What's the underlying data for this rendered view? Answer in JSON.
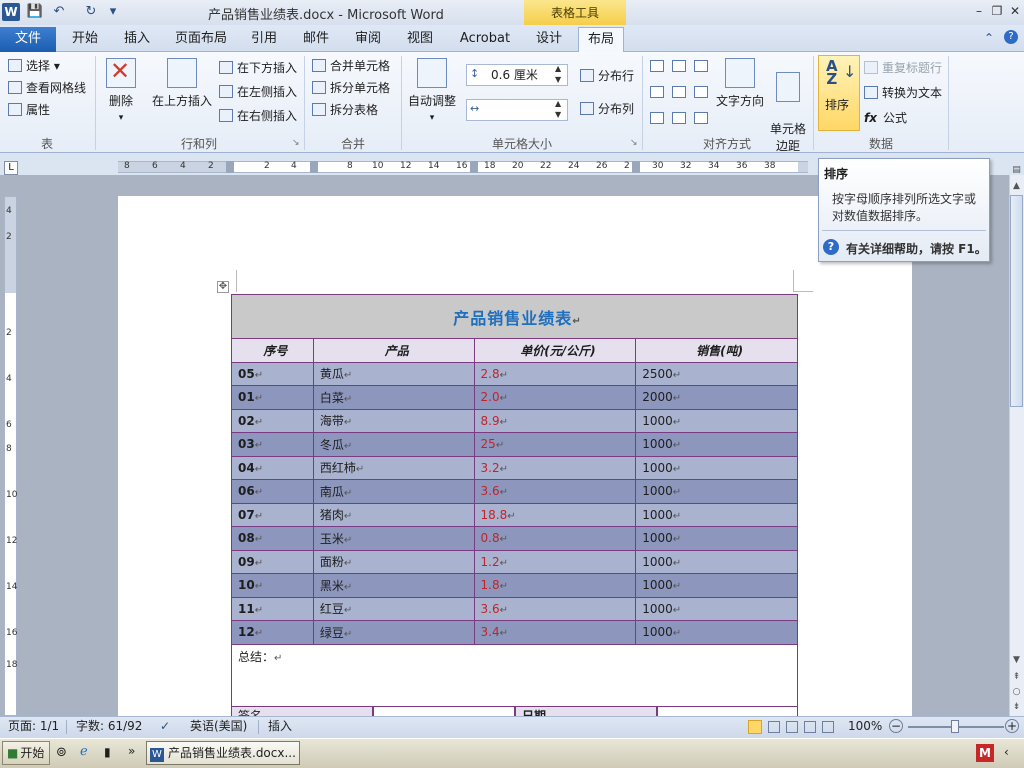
{
  "app": {
    "title": "产品销售业绩表.docx - Microsoft Word",
    "context_tab": "表格工具"
  },
  "tabs": [
    "文件",
    "开始",
    "插入",
    "页面布局",
    "引用",
    "邮件",
    "审阅",
    "视图",
    "Acrobat",
    "设计",
    "布局"
  ],
  "ribbon": {
    "table_group": {
      "label": "表",
      "select": "选择 ▾",
      "view_gridlines": "查看网格线",
      "properties": "属性"
    },
    "rows_cols_group": {
      "label": "行和列",
      "delete": "删除",
      "insert_above": "在上方插入",
      "insert_below": "在下方插入",
      "insert_left": "在左侧插入",
      "insert_right": "在右侧插入"
    },
    "merge_group": {
      "label": "合并",
      "merge_cells": "合并单元格",
      "split_cells": "拆分单元格",
      "split_table": "拆分表格"
    },
    "cell_size_group": {
      "label": "单元格大小",
      "autofit": "自动调整",
      "height_value": "0.6 厘米",
      "width_value": "",
      "distribute_rows": "分布行",
      "distribute_cols": "分布列"
    },
    "align_group": {
      "label": "对齐方式",
      "text_direction": "文字方向",
      "cell_margins": "单元格\n边距"
    },
    "data_group": {
      "label": "数据",
      "sort": "排序",
      "repeat_header": "重复标题行",
      "convert_to_text": "转换为文本",
      "formula": "公式"
    }
  },
  "ruler": {
    "h_ticks": [
      "8",
      "6",
      "4",
      "2",
      "2",
      "4",
      "8",
      "10",
      "12",
      "14",
      "16",
      "18",
      "20",
      "22",
      "24",
      "26",
      "2",
      "30",
      "32",
      "34",
      "36",
      "38"
    ],
    "v_ticks": [
      "4",
      "2",
      "2",
      "4",
      "6",
      "8",
      "10",
      "12",
      "14",
      "16",
      "18"
    ]
  },
  "tooltip": {
    "title": "排序",
    "body": "按字母顺序排列所选文字或对数值数据排序。",
    "help": "有关详细帮助，请按 F1。"
  },
  "document": {
    "table_title": "产品销售业绩表",
    "headers": [
      "序号",
      "产品",
      "单价(元/公斤)",
      "销售(吨)"
    ],
    "rows": [
      {
        "id": "05",
        "product": "黄瓜",
        "price": "2.8",
        "sales": "2500"
      },
      {
        "id": "01",
        "product": "白菜",
        "price": "2.0",
        "sales": "2000"
      },
      {
        "id": "02",
        "product": "海带",
        "price": "8.9",
        "sales": "1000"
      },
      {
        "id": "03",
        "product": "冬瓜",
        "price": "25",
        "sales": "1000"
      },
      {
        "id": "04",
        "product": "西红柿",
        "price": "3.2",
        "sales": "1000"
      },
      {
        "id": "06",
        "product": "南瓜",
        "price": "3.6",
        "sales": "1000"
      },
      {
        "id": "07",
        "product": "猪肉",
        "price": "18.8",
        "sales": "1000"
      },
      {
        "id": "08",
        "product": "玉米",
        "price": "0.8",
        "sales": "1000"
      },
      {
        "id": "09",
        "product": "面粉",
        "price": "1.2",
        "sales": "1000"
      },
      {
        "id": "10",
        "product": "黑米",
        "price": "1.8",
        "sales": "1000"
      },
      {
        "id": "11",
        "product": "红豆",
        "price": "3.6",
        "sales": "1000"
      },
      {
        "id": "12",
        "product": "绿豆",
        "price": "3.4",
        "sales": "1000"
      }
    ],
    "summary_label": "总结：",
    "signature_label": "签名",
    "date_label": "日期"
  },
  "status": {
    "page": "页面: 1/1",
    "words": "字数: 61/92",
    "language": "英语(美国)",
    "mode": "插入",
    "zoom": "100%"
  },
  "taskbar": {
    "start": "开始",
    "word_task": "产品销售业绩表.docx..."
  },
  "colors": {
    "accent": "#1b5db0",
    "title_text": "#1f6fbf",
    "price_text": "#c0242b",
    "row_light": "#a9b3cf",
    "row_dark": "#8d97bd",
    "table_border": "#7b3b82",
    "sort_highlight": "#ffd766"
  }
}
